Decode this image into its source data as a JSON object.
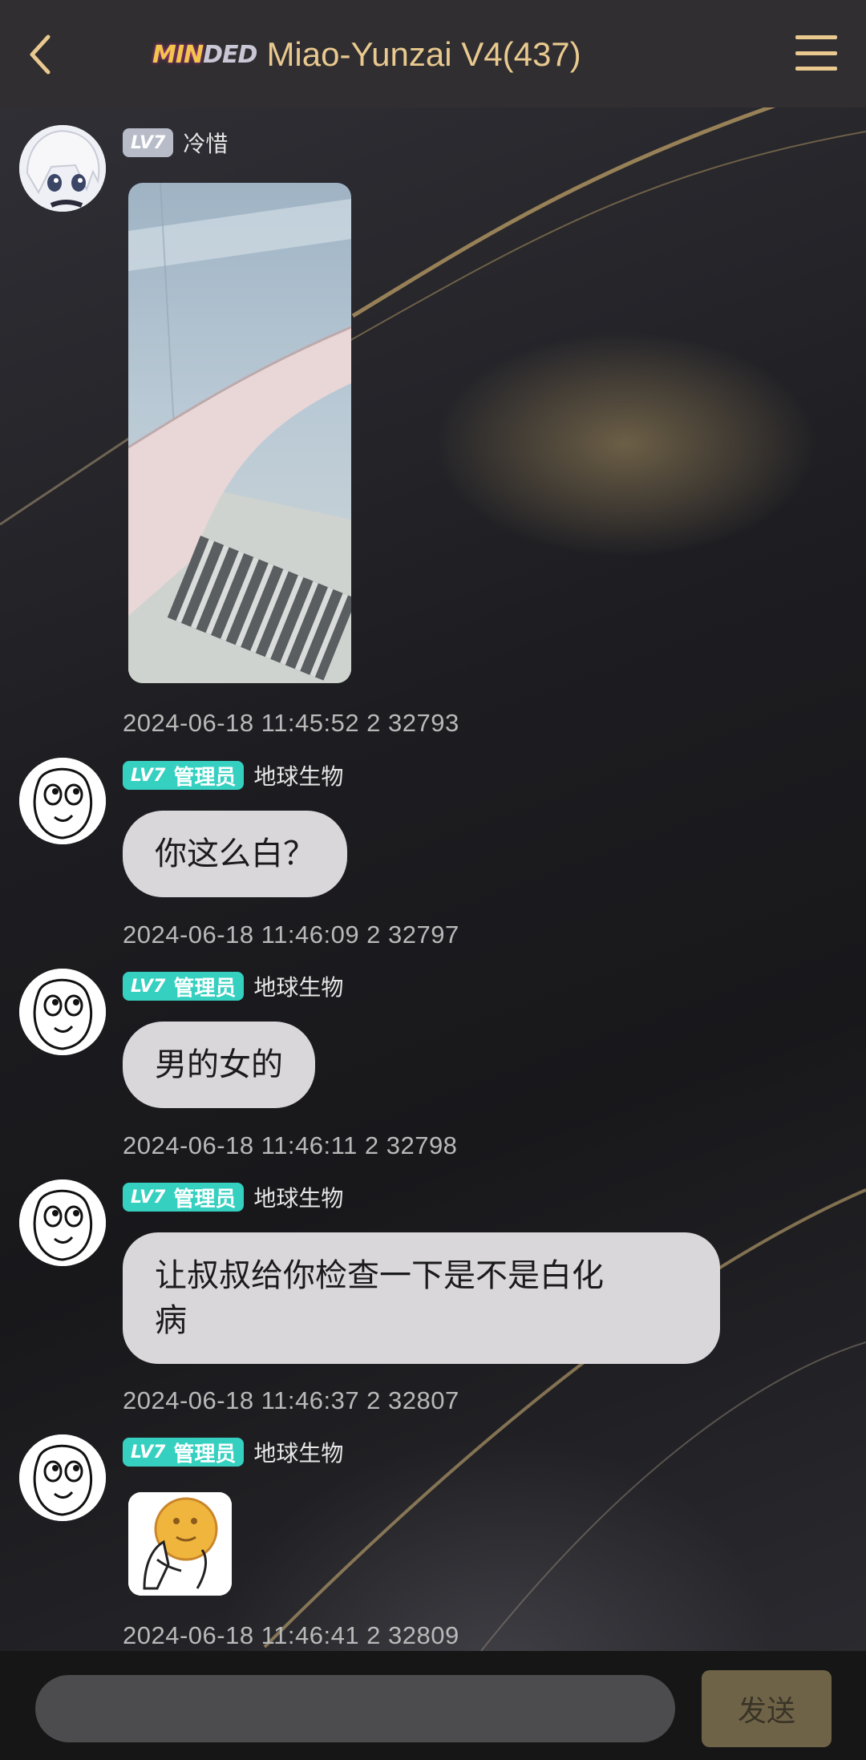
{
  "header": {
    "logo_part1": "MIN",
    "logo_part2": "DED",
    "title": "Miao-Yunzai V4(437)"
  },
  "messages": [
    {
      "level": "LV7",
      "role": "",
      "nickname": "冷惜",
      "type": "image",
      "timestamp": "2024-06-18 11:45:52 2 32793"
    },
    {
      "level": "LV7",
      "role": "管理员",
      "nickname": "地球生物",
      "type": "text",
      "text": "你这么白？",
      "timestamp": "2024-06-18 11:46:09 2 32797"
    },
    {
      "level": "LV7",
      "role": "管理员",
      "nickname": "地球生物",
      "type": "text",
      "text": "男的女的",
      "timestamp": "2024-06-18 11:46:11 2 32798"
    },
    {
      "level": "LV7",
      "role": "管理员",
      "nickname": "地球生物",
      "type": "text",
      "text_line1": "让叔叔给你检查一下是不是白化",
      "text_line2": "病",
      "timestamp": "2024-06-18 11:46:37 2 32807"
    },
    {
      "level": "LV7",
      "role": "管理员",
      "nickname": "地球生物",
      "type": "sticker",
      "timestamp": "2024-06-18 11:46:41 2 32809"
    }
  ],
  "composer": {
    "input_value": "",
    "send_label": "发送"
  },
  "colors": {
    "accent": "#e9c98f",
    "badge_admin": "#35d0c0",
    "badge_user": "#b8bcc8",
    "bubble": "#dad7db",
    "send_button": "#6f6347"
  },
  "icons": {
    "back": "chevron-left-icon",
    "menu": "hamburger-menu-icon"
  }
}
